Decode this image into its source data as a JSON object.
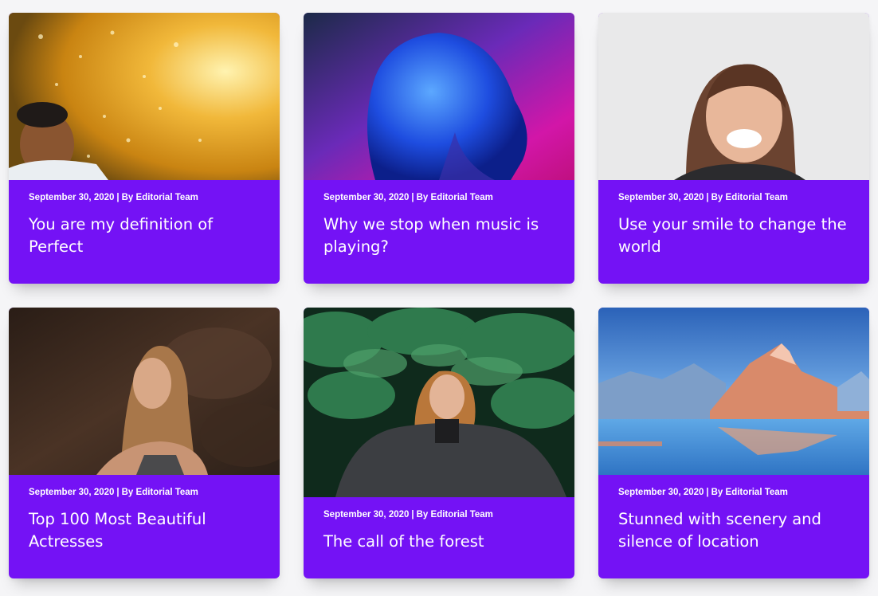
{
  "colors": {
    "card_background": "#7412f5",
    "page_background": "#f5f5f7",
    "text": "#ffffff"
  },
  "posts": [
    {
      "date": "September 30, 2020",
      "separator": "|",
      "author": "By Editorial Team",
      "title": "You are my definition of Perfect",
      "image": "boy-in-golden-sparkling-water-photo"
    },
    {
      "date": "September 30, 2020",
      "separator": "|",
      "author": "By Editorial Team",
      "title": "Why we stop when music is playing?",
      "image": "woman-face-in-blue-neon-light-photo"
    },
    {
      "date": "September 30, 2020",
      "separator": "|",
      "author": "By Editorial Team",
      "title": "Use your smile to change the world",
      "image": "laughing-woman-portrait-photo"
    },
    {
      "date": "September 30, 2020",
      "separator": "|",
      "author": "By Editorial Team",
      "title": "Top 100 Most Beautiful Actresses",
      "image": "woman-in-front-of-rocks-photo"
    },
    {
      "date": "September 30, 2020",
      "separator": "|",
      "author": "By Editorial Team",
      "title": "The call of the forest",
      "image": "smiling-woman-under-pine-branches-photo"
    },
    {
      "date": "September 30, 2020",
      "separator": "|",
      "author": "By Editorial Team",
      "title": "Stunned with scenery and silence of location",
      "image": "snowy-mountains-over-lake-photo"
    }
  ]
}
